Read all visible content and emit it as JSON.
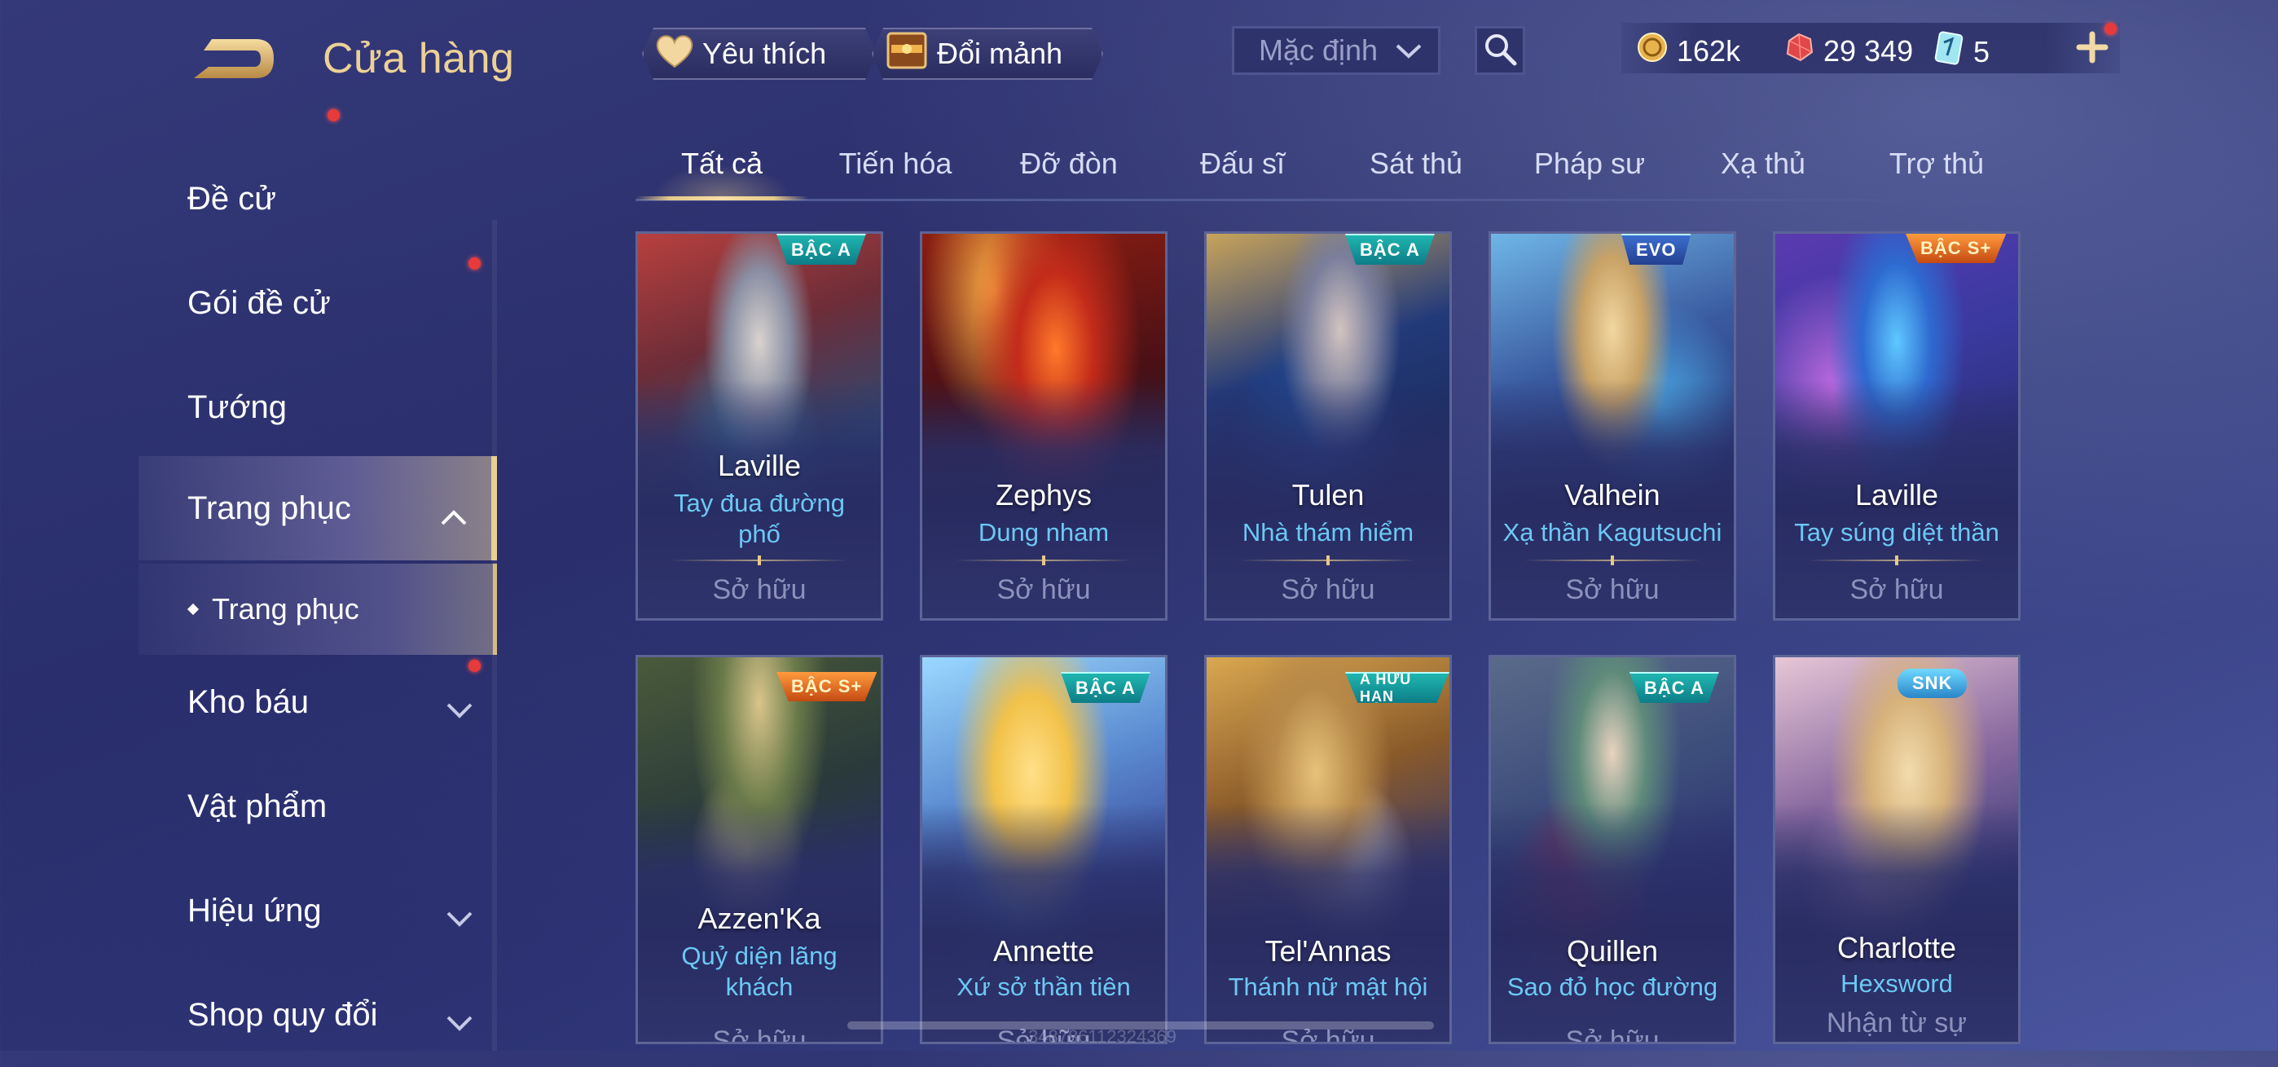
{
  "header": {
    "title": "Cửa hàng",
    "favorite_label": "Yêu thích",
    "exchange_label": "Đổi mảnh",
    "sort_value": "Mặc định"
  },
  "currencies": {
    "gold": "162k",
    "gems": "29 349",
    "tickets": "5"
  },
  "sidebar": {
    "items": [
      {
        "label": "Đề cử"
      },
      {
        "label": "Gói đề cử"
      },
      {
        "label": "Tướng"
      },
      {
        "label": "Trang phục"
      },
      {
        "label": "Kho báu"
      },
      {
        "label": "Vật phẩm"
      },
      {
        "label": "Hiệu ứng"
      },
      {
        "label": "Shop quy đổi"
      }
    ],
    "sub_item": "Trang phục"
  },
  "tabs": [
    "Tất cả",
    "Tiến hóa",
    "Đỡ đòn",
    "Đấu sĩ",
    "Sát thủ",
    "Pháp sư",
    "Xạ thủ",
    "Trợ thủ"
  ],
  "cards": [
    {
      "hero": "Laville",
      "skin": "Tay đua đường phố",
      "status": "Sở hữu",
      "badge": "BẬC A",
      "badge_type": "a"
    },
    {
      "hero": "Zephys",
      "skin": "Dung nham",
      "status": "Sở hữu",
      "badge": "",
      "badge_type": ""
    },
    {
      "hero": "Tulen",
      "skin": "Nhà thám hiểm",
      "status": "Sở hữu",
      "badge": "BẬC A",
      "badge_type": "a"
    },
    {
      "hero": "Valhein",
      "skin": "Xạ thần Kagutsuchi",
      "status": "Sở hữu",
      "badge": "EVO",
      "badge_type": "a"
    },
    {
      "hero": "Laville",
      "skin": "Tay súng diệt thần",
      "status": "Sở hữu",
      "badge": "BẬC S+",
      "badge_type": "s"
    },
    {
      "hero": "Azzen'Ka",
      "skin": "Quỷ diện lãng khách",
      "status": "Sở hữu",
      "badge": "BẬC S+",
      "badge_type": "s"
    },
    {
      "hero": "Annette",
      "skin": "Xứ sở thần tiên",
      "status": "Sở hữu",
      "badge": "BẬC A",
      "badge_type": "a"
    },
    {
      "hero": "Tel'Annas",
      "skin": "Thánh nữ mật hội",
      "status": "Sở hữu",
      "badge": "A HỮU HẠN",
      "badge_type": "a"
    },
    {
      "hero": "Quillen",
      "skin": "Sao đỏ học đường",
      "status": "Sở hữu",
      "badge": "BẬC A",
      "badge_type": "a"
    },
    {
      "hero": "Charlotte",
      "skin": "Hexsword",
      "status": "Nhận từ sự",
      "badge": "SNK",
      "badge_type": "a"
    }
  ],
  "watermark": "…348786112324369",
  "colors": {
    "accent_gold": "#e8cf96",
    "skin_blue": "#6cc8f4",
    "notification_red": "#e83a3a"
  }
}
